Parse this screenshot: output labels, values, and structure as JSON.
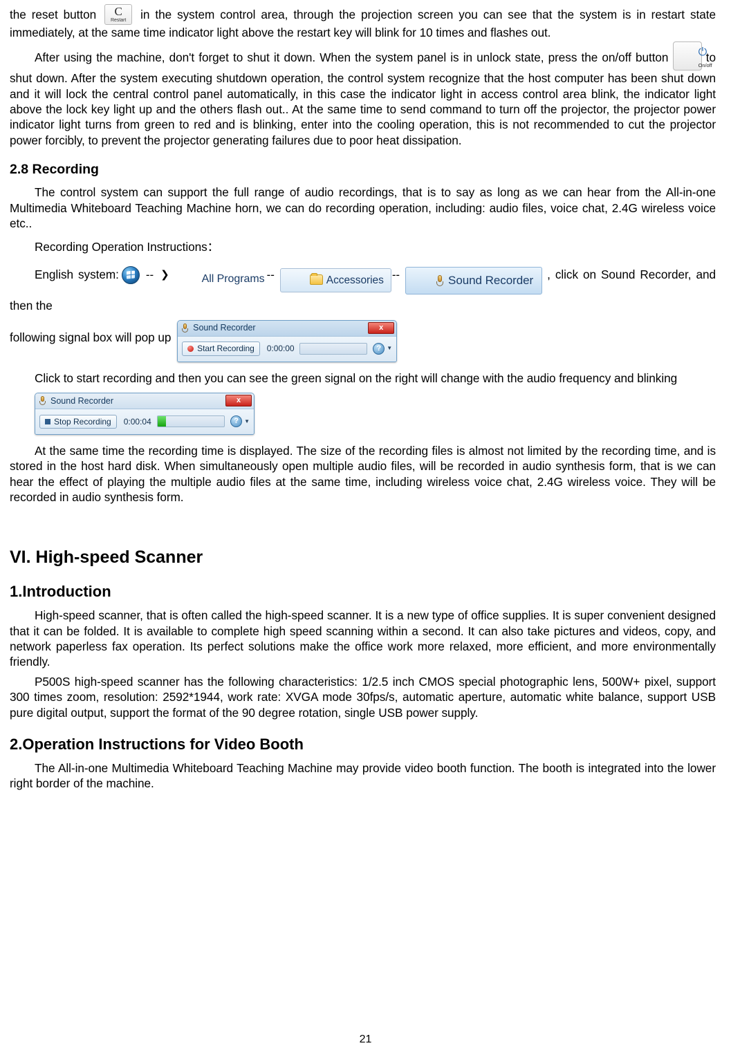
{
  "document": {
    "page_number": "21",
    "paragraphs": {
      "p1_part1": "the reset button",
      "p1_part2": "in the system control area, through the projection screen you can see that the system is in restart state immediately, at the same time indicator light above the restart key will blink for 10 times and flashes out.",
      "p2_part1": "After using the machine, don't forget to shut it down. When the system panel is in unlock state, press the on/off button",
      "p2_part2": "to shut down. After the system executing shutdown operation, the control system recognize that the host computer has been shut down and it will lock the central control panel automatically, in this case the indicator light in access control area blink, the indicator light above the lock key light up and the others flash out.. At the same time to send command to turn off the projector, the projector power indicator light turns from green to red and is blinking, enter into the cooling operation, this is not recommended to cut the projector power forcibly, to prevent the projector generating failures due to poor heat dissipation.",
      "recording_intro": "The control system can support the full range of audio recordings, that is to say as long as we can hear from the All-in-one Multimedia Whiteboard Teaching Machine horn, we can do recording operation, including: audio files, voice chat, 2.4G wireless voice etc..",
      "recording_ops_label": "Recording Operation Instructions：",
      "english_system_label": "English system:",
      "after_chips_text": ", click on Sound Recorder, and then the",
      "popup_lead": "following signal box will pop up",
      "click_to_start": "Click to start recording and then you can see the green signal on the right will change with the audio frequency and blinking",
      "same_time_text": "At the same time the recording time is displayed. The size of the recording files is almost not limited by the recording time, and is stored in the host hard disk. When simultaneously open multiple audio files, will be recorded in audio synthesis form, that is we can hear the effect of playing the multiple audio files at the same time, including wireless voice chat, 2.4G wireless voice. They will be recorded in audio synthesis form.",
      "intro_p1": "High-speed scanner, that is often called the high-speed scanner. It is a new type of office supplies. It is super convenient designed that it can be folded. It is available to complete high speed scanning within a second. It can also take pictures and videos, copy, and network paperless fax operation. Its perfect solutions make the office work more relaxed, more efficient, and more environmentally friendly.",
      "intro_p2": "P500S high-speed scanner has the following characteristics: 1/2.5 inch CMOS special photographic lens, 500W+ pixel, support 300 times zoom, resolution: 2592*1944, work rate: XVGA mode 30fps/s, automatic aperture, automatic white balance, support USB pure digital output, support the format of the 90 degree rotation, single USB power supply.",
      "video_booth_p1": "The All-in-one Multimedia Whiteboard Teaching Machine may provide video booth function. The booth is integrated into the lower right border of the machine."
    },
    "headings": {
      "recording": "2.8 Recording",
      "high_speed_scanner": "VI. High-speed Scanner",
      "introduction": "1.Introduction",
      "operation_instructions": "2.Operation Instructions for Video Booth"
    },
    "icons": {
      "restart_button_label": "Restart",
      "restart_button_glyph": "C",
      "onoff_button_label": "On/off",
      "onoff_button_glyph": "⏻",
      "arrow_glyph": "❯",
      "dash_separator": "--",
      "all_programs_label": "All Programs",
      "accessories_label": "Accessories",
      "sound_recorder_label": "Sound Recorder"
    },
    "sound_recorder_idle": {
      "title": "Sound Recorder",
      "close_label": "x",
      "record_button": "Start Recording",
      "timecode": "0:00:00",
      "help_label": "?",
      "caret": "▼"
    },
    "sound_recorder_recording": {
      "title": "Sound Recorder",
      "close_label": "x",
      "record_button": "Stop Recording",
      "timecode": "0:00:04",
      "help_label": "?",
      "caret": "▼"
    }
  }
}
